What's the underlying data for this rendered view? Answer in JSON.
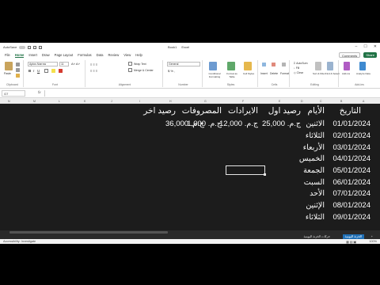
{
  "titlebar": {
    "autosave_label": "AutoSave",
    "doc_title": "Book1",
    "app_name": "Excel",
    "search_placeholder": "Search"
  },
  "menu": {
    "items": [
      "File",
      "Home",
      "Insert",
      "Draw",
      "Page Layout",
      "Formulas",
      "Data",
      "Review",
      "View",
      "Help"
    ],
    "active": "Home",
    "comments_label": "Comments",
    "share_label": "Share"
  },
  "ribbon": {
    "paste_label": "Paste",
    "font_name": "Aptos Narrow",
    "font_size": "11",
    "wrap_text": "Wrap Text",
    "merge_center": "Merge & Center",
    "number_format": "General",
    "conditional_formatting": "Conditional Formatting",
    "format_as_table": "Format as Table",
    "cell_styles": "Cell Styles",
    "insert": "Insert",
    "delete": "Delete",
    "format": "Format",
    "autosum": "AutoSum",
    "fill": "Fill",
    "clear": "Clear",
    "sort_filter": "Sort & Filter",
    "find_select": "Find & Select",
    "addins": "Add-ins",
    "analyze_data": "Analyze Data",
    "groups": {
      "clipboard": "Clipboard",
      "font": "Font",
      "alignment": "Alignment",
      "number": "Number",
      "styles": "Styles",
      "cells": "Cells",
      "editing": "Editing",
      "addins": "Add-ins"
    }
  },
  "formula_bar": {
    "name_box": "G7",
    "fx": "fx"
  },
  "columns": [
    "N",
    "M",
    "L",
    "K",
    "J",
    "I",
    "H",
    "G",
    "F",
    "E",
    "D",
    "C",
    "B",
    "A"
  ],
  "table": {
    "headers": {
      "date": "التاريخ",
      "day": "الأيام",
      "opening": "رصيد اول",
      "revenue": "الايرادات",
      "expenses": "المصروفات",
      "closing": "رصيد اخر"
    },
    "first_row": {
      "opening": "ج.م. 25,000",
      "revenue": "ج.م. 12,000",
      "expenses": "ج.م. 1,000",
      "closing": "ج.م. 36,000"
    },
    "rows": [
      {
        "date": "01/01/2024",
        "day": "الاثنين"
      },
      {
        "date": "02/01/2024",
        "day": "الثلاثاء"
      },
      {
        "date": "03/01/2024",
        "day": "الأربعاء"
      },
      {
        "date": "04/01/2024",
        "day": "الخميس"
      },
      {
        "date": "05/01/2024",
        "day": "الجمعة"
      },
      {
        "date": "06/01/2024",
        "day": "السبت"
      },
      {
        "date": "07/01/2024",
        "day": "الأحد"
      },
      {
        "date": "08/01/2024",
        "day": "الإثنين"
      },
      {
        "date": "09/01/2024",
        "day": "الثلاثاء"
      }
    ]
  },
  "sheet_tabs": {
    "tab1": "حركات الخزنة اليومية",
    "tab2": "الخزنة اليومية"
  },
  "status": {
    "accessibility": "Accessibility: Investigate",
    "zoom": "100%"
  },
  "colors": {
    "accent": "#217346",
    "sheet_bg": "#1c1c1c",
    "active_tab": "#1f6fb5"
  }
}
